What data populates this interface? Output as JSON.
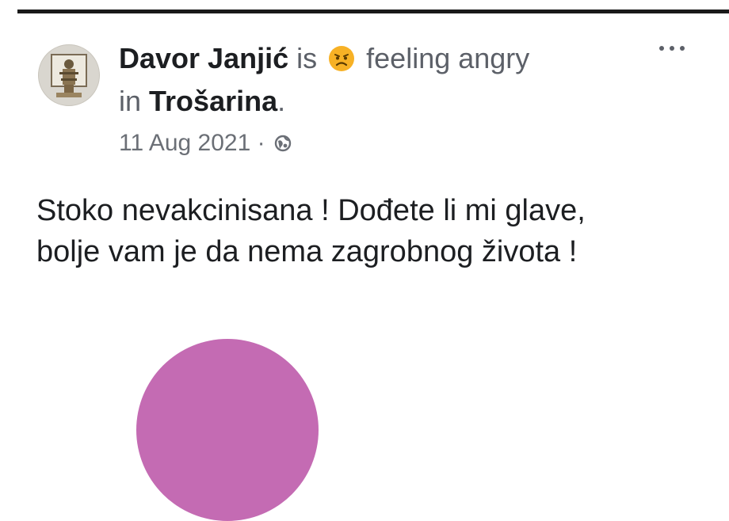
{
  "post": {
    "author": "Davor Janjić",
    "is_word": "is",
    "feeling_emoji": "angry-face",
    "feeling_text": "feeling angry",
    "in_word": "in",
    "place": "Trošarina",
    "place_suffix": ".",
    "date": "11 Aug 2021",
    "separator": "·",
    "privacy_icon": "globe-icon",
    "more_icon": "more-options-icon",
    "text_line1": "Stoko nevakcinisana ! Dođete li mi glave,",
    "text_line2": "bolje vam je da nema zagrobnog života !"
  },
  "colors": {
    "text": "#1c1e21",
    "muted": "#6b6f76",
    "emoji_yellow": "#f7b125",
    "attachment_pink": "#c46bb3"
  }
}
